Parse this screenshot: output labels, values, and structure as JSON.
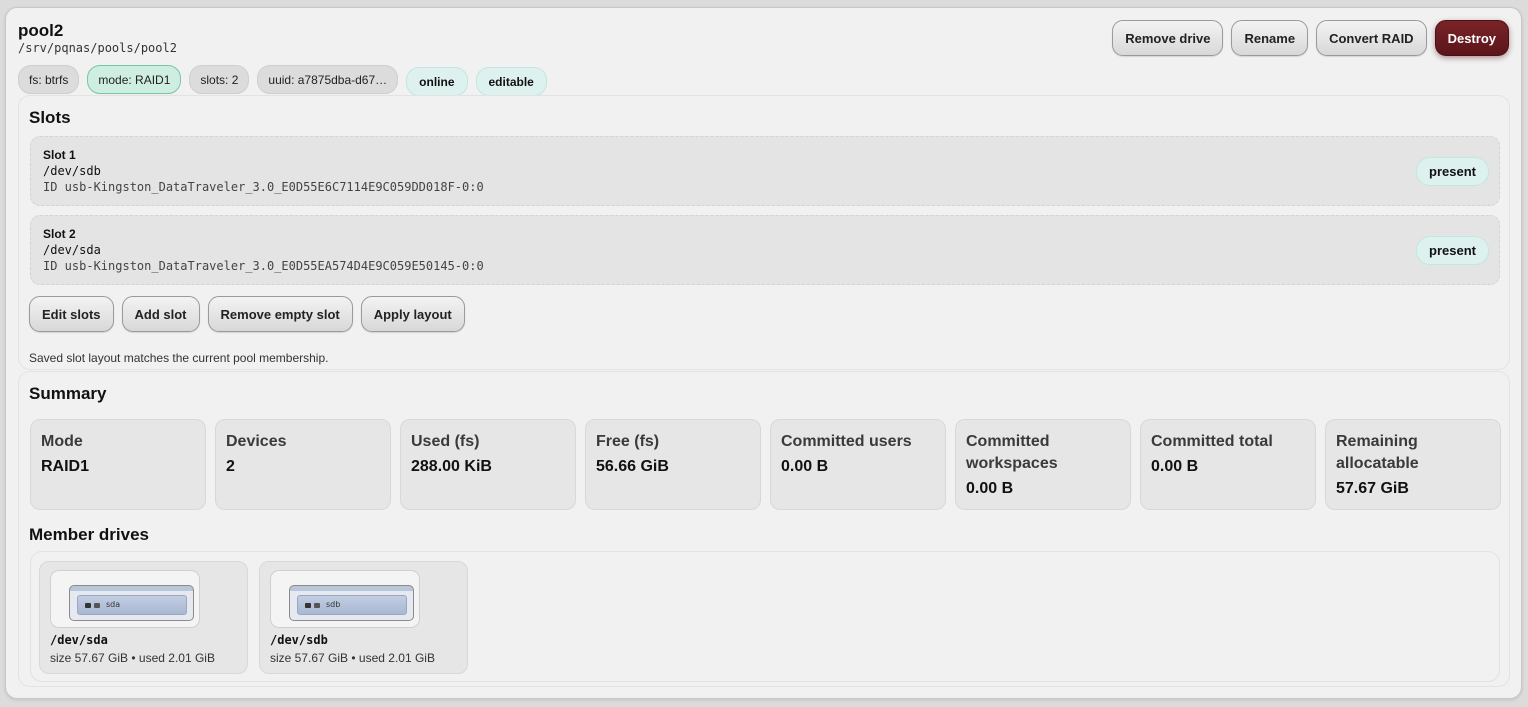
{
  "pool": {
    "name": "pool2",
    "path": "/srv/pqnas/pools/pool2",
    "actions": {
      "remove_drive": "Remove drive",
      "rename": "Rename",
      "convert_raid": "Convert RAID",
      "destroy": "Destroy"
    },
    "chips": {
      "fs": "fs: btrfs",
      "mode": "mode: RAID1",
      "slots": "slots: 2",
      "uuid": "uuid: a7875dba-d67…",
      "online": "online",
      "editable": "editable"
    },
    "colors": {
      "destroy": "#6b1c21",
      "mode_chip": "#cdeee1",
      "status_chip": "#ddf2ee"
    }
  },
  "slots": {
    "title": "Slots",
    "items": [
      {
        "name": "Slot 1",
        "device": "/dev/sdb",
        "id": "ID usb-Kingston_DataTraveler_3.0_E0D55E6C7114E9C059DD018F-0:0",
        "status": "present"
      },
      {
        "name": "Slot 2",
        "device": "/dev/sda",
        "id": "ID usb-Kingston_DataTraveler_3.0_E0D55EA574D4E9C059E50145-0:0",
        "status": "present"
      }
    ],
    "actions": {
      "edit": "Edit slots",
      "add": "Add slot",
      "remove_empty": "Remove empty slot",
      "apply": "Apply layout"
    },
    "note": "Saved slot layout matches the current pool membership."
  },
  "summary": {
    "title": "Summary",
    "stats": [
      {
        "label": "Mode",
        "value": "RAID1"
      },
      {
        "label": "Devices",
        "value": "2"
      },
      {
        "label": "Used (fs)",
        "value": "288.00 KiB"
      },
      {
        "label": "Free (fs)",
        "value": "56.66 GiB"
      },
      {
        "label": "Committed users",
        "value": "0.00 B"
      },
      {
        "label": "Committed workspaces",
        "value": "0.00 B"
      },
      {
        "label": "Committed total",
        "value": "0.00 B"
      },
      {
        "label": "Remaining allocatable",
        "value": "57.67 GiB"
      }
    ]
  },
  "members": {
    "title": "Member drives",
    "drives": [
      {
        "label": "sda",
        "device": "/dev/sda",
        "size": "size 57.67 GiB • used 2.01 GiB",
        "icon": "usb-drive-icon"
      },
      {
        "label": "sdb",
        "device": "/dev/sdb",
        "size": "size 57.67 GiB • used 2.01 GiB",
        "icon": "usb-drive-icon"
      }
    ]
  }
}
